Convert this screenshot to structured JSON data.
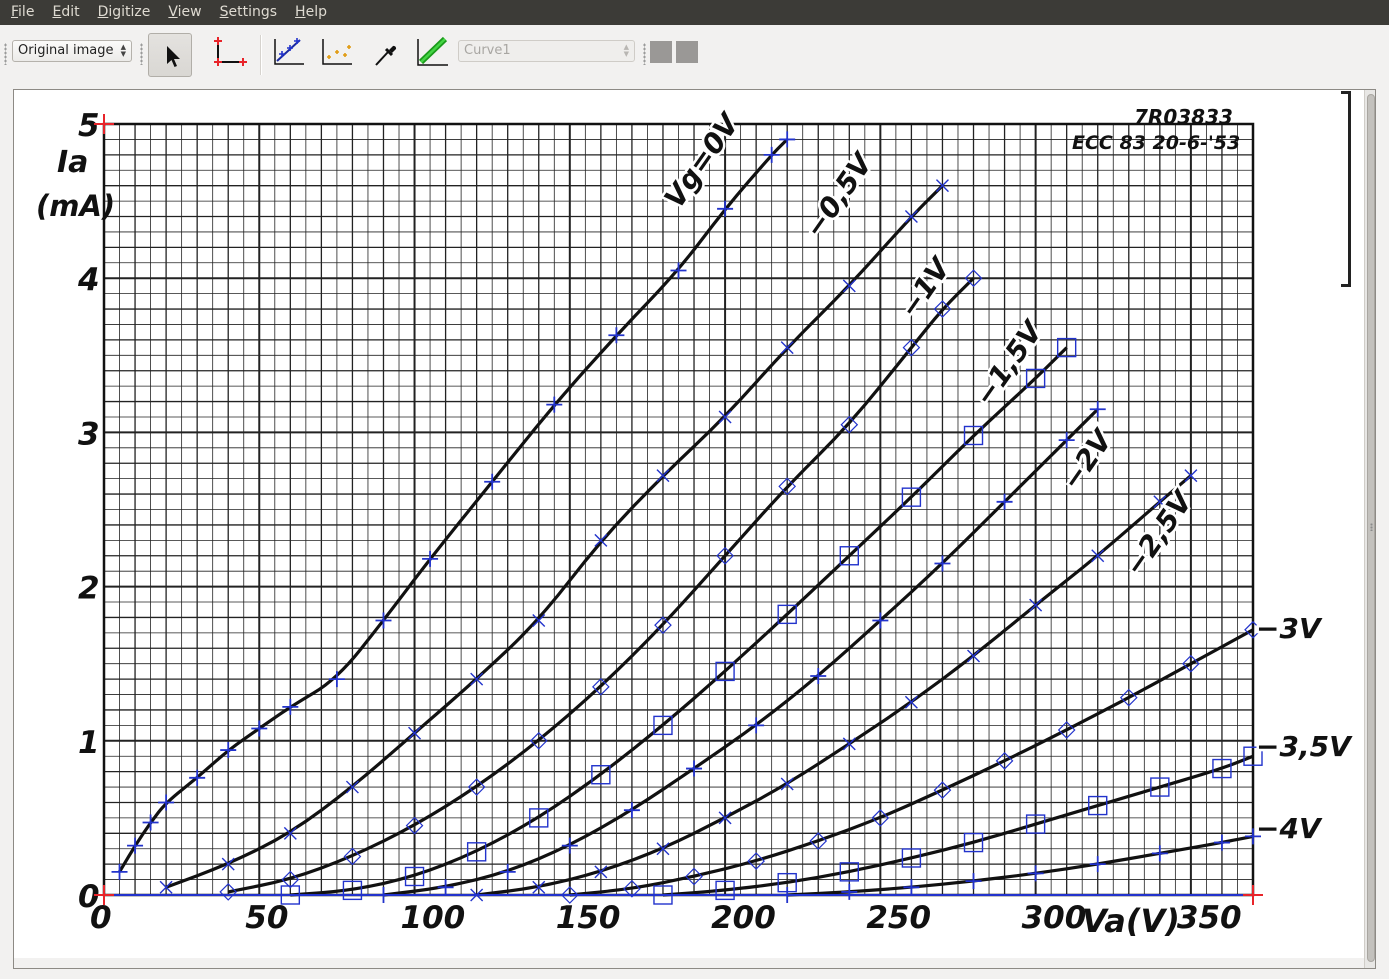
{
  "menubar": {
    "items": [
      "File",
      "Edit",
      "Digitize",
      "View",
      "Settings",
      "Help"
    ]
  },
  "toolbar": {
    "view_select": "Original image",
    "curve_select": "Curve1",
    "tools": [
      "select-tool",
      "axis-points-tool",
      "curve-points-tool",
      "point-match-tool",
      "color-picker-tool",
      "segment-fill-tool"
    ]
  },
  "graph": {
    "stamp_line1": "7R03833",
    "stamp_line2": "ECC 83  20-6-'53",
    "y_label": "Ia",
    "y_unit": "(mA)",
    "x_label": "Va(V)",
    "x_ticks": [
      "0",
      "50",
      "100",
      "150",
      "200",
      "250",
      "300",
      "350"
    ],
    "y_ticks": [
      "0",
      "1",
      "2",
      "3",
      "4",
      "5"
    ],
    "curve_labels": [
      "Vg=0V",
      "−0,5V",
      "−1V",
      "−1,5V",
      "−2V",
      "−2,5V",
      "−3V",
      "−3,5V",
      "−4V"
    ]
  },
  "chart_data": {
    "type": "line",
    "title": "",
    "xlabel": "Va(V)",
    "ylabel": "Ia (mA)",
    "xlim": [
      0,
      370
    ],
    "ylim": [
      0,
      5
    ],
    "grid": true,
    "series": [
      {
        "name": "Vg=0V",
        "x": [
          5,
          10,
          15,
          20,
          30,
          40,
          50,
          60,
          75,
          90,
          105,
          125,
          145,
          165,
          185,
          200,
          215,
          220
        ],
        "y": [
          0.15,
          0.32,
          0.47,
          0.6,
          0.76,
          0.94,
          1.08,
          1.22,
          1.4,
          1.78,
          2.18,
          2.68,
          3.18,
          3.63,
          4.05,
          4.45,
          4.8,
          4.9
        ]
      },
      {
        "name": "−0,5V",
        "x": [
          20,
          40,
          60,
          80,
          100,
          120,
          140,
          160,
          180,
          200,
          220,
          240,
          260,
          270
        ],
        "y": [
          0.05,
          0.2,
          0.4,
          0.7,
          1.05,
          1.4,
          1.78,
          2.3,
          2.72,
          3.1,
          3.55,
          3.95,
          4.4,
          4.6
        ]
      },
      {
        "name": "−1V",
        "x": [
          40,
          60,
          80,
          100,
          120,
          140,
          160,
          180,
          200,
          220,
          240,
          260,
          270,
          280
        ],
        "y": [
          0.02,
          0.1,
          0.25,
          0.45,
          0.7,
          1.0,
          1.35,
          1.75,
          2.2,
          2.65,
          3.05,
          3.55,
          3.8,
          4.0
        ]
      },
      {
        "name": "−1,5V",
        "x": [
          60,
          80,
          100,
          120,
          140,
          160,
          180,
          200,
          220,
          240,
          260,
          280,
          300,
          310
        ],
        "y": [
          0.0,
          0.03,
          0.12,
          0.28,
          0.5,
          0.78,
          1.1,
          1.45,
          1.82,
          2.2,
          2.58,
          2.98,
          3.35,
          3.55
        ]
      },
      {
        "name": "−2V",
        "x": [
          90,
          110,
          130,
          150,
          170,
          190,
          210,
          230,
          250,
          270,
          290,
          310,
          320
        ],
        "y": [
          0.0,
          0.05,
          0.15,
          0.32,
          0.55,
          0.82,
          1.1,
          1.42,
          1.78,
          2.15,
          2.55,
          2.95,
          3.15
        ]
      },
      {
        "name": "−2,5V",
        "x": [
          120,
          140,
          160,
          180,
          200,
          220,
          240,
          260,
          280,
          300,
          320,
          340,
          350
        ],
        "y": [
          0.0,
          0.05,
          0.15,
          0.3,
          0.5,
          0.72,
          0.98,
          1.25,
          1.55,
          1.88,
          2.2,
          2.55,
          2.72
        ]
      },
      {
        "name": "−3V",
        "x": [
          150,
          170,
          190,
          210,
          230,
          250,
          270,
          290,
          310,
          330,
          350,
          370
        ],
        "y": [
          0.0,
          0.04,
          0.12,
          0.22,
          0.35,
          0.5,
          0.68,
          0.87,
          1.07,
          1.28,
          1.5,
          1.72
        ]
      },
      {
        "name": "−3,5V",
        "x": [
          180,
          200,
          220,
          240,
          260,
          280,
          300,
          320,
          340,
          360,
          370
        ],
        "y": [
          0.0,
          0.03,
          0.08,
          0.15,
          0.24,
          0.34,
          0.46,
          0.58,
          0.7,
          0.82,
          0.9
        ]
      },
      {
        "name": "−4V",
        "x": [
          220,
          240,
          260,
          280,
          300,
          320,
          340,
          360,
          370
        ],
        "y": [
          0.0,
          0.02,
          0.05,
          0.09,
          0.14,
          0.2,
          0.27,
          0.34,
          0.38
        ]
      }
    ]
  },
  "colors": {
    "menubar": "#3c3b37",
    "menu_text": "#dfdbd2",
    "grid": "#222222",
    "curve": "#111111",
    "marker": "#2233cc",
    "axis_point": "#e8242a"
  }
}
